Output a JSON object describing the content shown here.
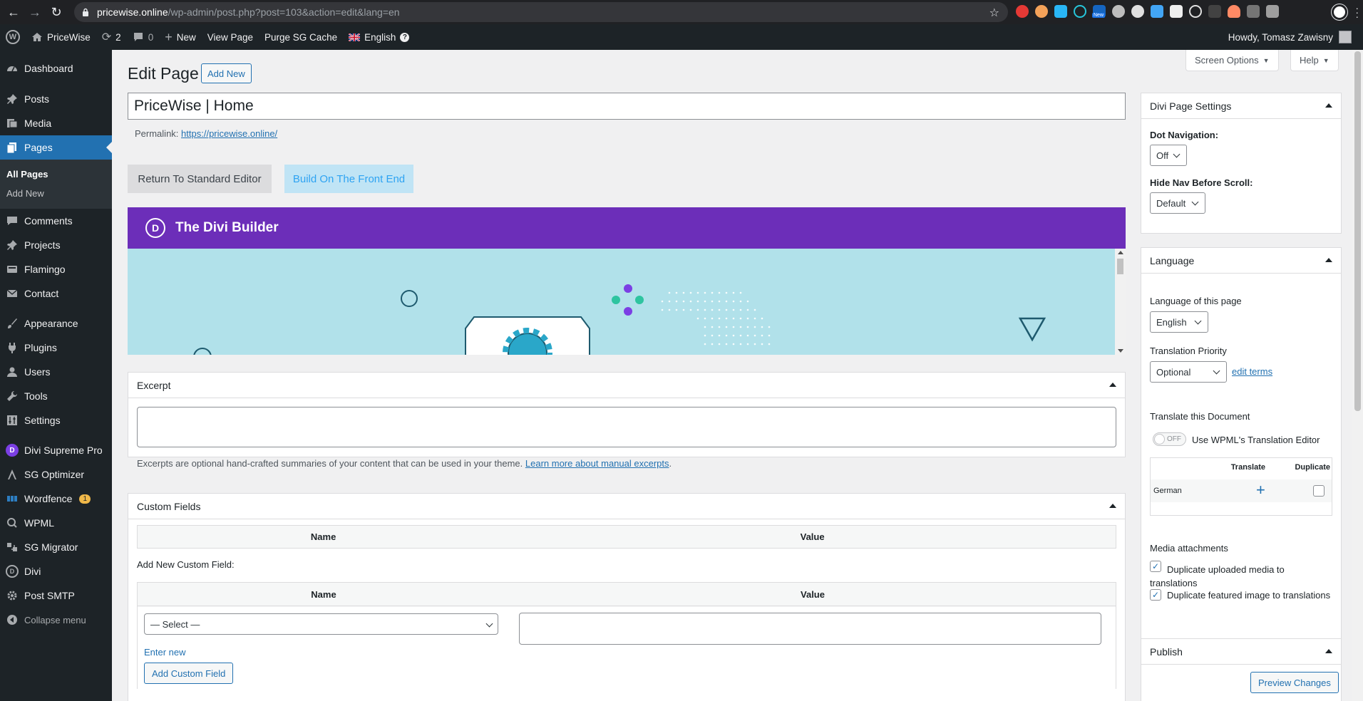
{
  "browser": {
    "url_host": "pricewise.online",
    "url_path": "/wp-admin/post.php?post=103&action=edit&lang=en",
    "ext_badge": "New"
  },
  "adminbar": {
    "site": "PriceWise",
    "updates": "2",
    "comments": "0",
    "new": "New",
    "view_page": "View Page",
    "purge": "Purge SG Cache",
    "language": "English",
    "howdy": "Howdy, Tomasz Zawisny"
  },
  "sidebar": {
    "dashboard": "Dashboard",
    "posts": "Posts",
    "media": "Media",
    "pages": "Pages",
    "all_pages": "All Pages",
    "add_new": "Add New",
    "comments": "Comments",
    "projects": "Projects",
    "flamingo": "Flamingo",
    "contact": "Contact",
    "appearance": "Appearance",
    "plugins": "Plugins",
    "users": "Users",
    "tools": "Tools",
    "settings": "Settings",
    "divi_supreme": "Divi Supreme Pro",
    "sg_optimizer": "SG Optimizer",
    "wordfence": "Wordfence",
    "wordfence_badge": "1",
    "wpml": "WPML",
    "sg_migrator": "SG Migrator",
    "divi": "Divi",
    "post_smtp": "Post SMTP",
    "collapse": "Collapse menu"
  },
  "editor": {
    "screen_options": "Screen Options",
    "help": "Help",
    "heading": "Edit Page",
    "add_new": "Add New",
    "title_value": "PriceWise | Home",
    "permalink_label": "Permalink:",
    "permalink_url": "https://pricewise.online/",
    "return_btn": "Return To Standard Editor",
    "front_btn": "Build On The Front End",
    "divi_title": "The Divi Builder",
    "divi_logo": "D"
  },
  "excerpt": {
    "title": "Excerpt",
    "note": "Excerpts are optional hand-crafted summaries of your content that can be used in your theme.",
    "link": "Learn more about manual excerpts",
    "period": "."
  },
  "custom_fields": {
    "title": "Custom Fields",
    "col_name": "Name",
    "col_value": "Value",
    "add_new_label": "Add New Custom Field:",
    "select_value": "— Select —",
    "enter_new": "Enter new",
    "add_btn": "Add Custom Field"
  },
  "divi_settings": {
    "title": "Divi Page Settings",
    "dot_nav_label": "Dot Navigation:",
    "dot_nav_value": "Off",
    "hide_nav_label": "Hide Nav Before Scroll:",
    "hide_nav_value": "Default"
  },
  "language_box": {
    "title": "Language",
    "lang_label": "Language of this page",
    "lang_value": "English",
    "priority_label": "Translation Priority",
    "priority_value": "Optional",
    "edit_terms": "edit terms",
    "translate_label": "Translate this Document",
    "toggle_state": "OFF",
    "toggle_label": "Use WPML's Translation Editor",
    "col_translate": "Translate",
    "col_duplicate": "Duplicate",
    "row_lang": "German",
    "media_label": "Media attachments",
    "dup_media": "Duplicate uploaded media to translations",
    "dup_featured": "Duplicate featured image to translations"
  },
  "publish": {
    "title": "Publish",
    "preview": "Preview Changes"
  },
  "colors": {
    "wp_blue": "#2271b1",
    "admin_dark": "#1d2327",
    "divi_purple": "#6c2eb9",
    "divi_preview_bg": "#b1e1ea"
  }
}
